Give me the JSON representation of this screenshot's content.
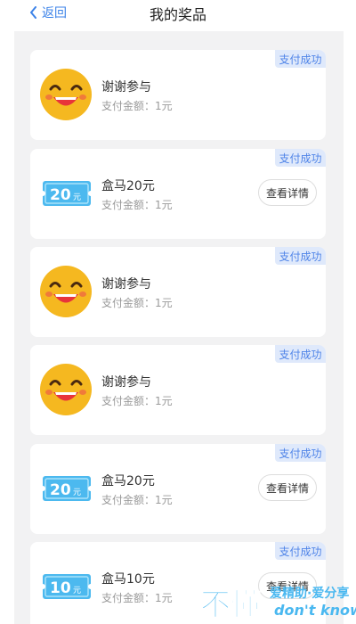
{
  "header": {
    "back_label": "返回",
    "title": "我的奖品"
  },
  "cards": [
    {
      "type": "smiley",
      "name": "谢谢参与",
      "amount": "支付金额：1元",
      "status": "支付成功",
      "has_detail": false
    },
    {
      "type": "coupon",
      "coupon_value": "20",
      "coupon_unit": "元",
      "name": "盒马20元",
      "amount": "支付金额：1元",
      "status": "支付成功",
      "has_detail": true,
      "detail_label": "查看详情"
    },
    {
      "type": "smiley",
      "name": "谢谢参与",
      "amount": "支付金额：1元",
      "status": "支付成功",
      "has_detail": false
    },
    {
      "type": "smiley",
      "name": "谢谢参与",
      "amount": "支付金额：1元",
      "status": "支付成功",
      "has_detail": false
    },
    {
      "type": "coupon",
      "coupon_value": "20",
      "coupon_unit": "元",
      "name": "盒马20元",
      "amount": "支付金额：1元",
      "status": "支付成功",
      "has_detail": true,
      "detail_label": "查看详情"
    },
    {
      "type": "coupon",
      "coupon_value": "10",
      "coupon_unit": "元",
      "name": "盒马10元",
      "amount": "支付金额：1元",
      "status": "支付成功",
      "has_detail": true,
      "detail_label": "查看详情"
    }
  ],
  "watermark": {
    "text_main": "不懂",
    "text_cn": "爱精助·爱分享",
    "text_en": "don't know"
  },
  "colors": {
    "accent": "#3b82e8",
    "badge_bg": "#dfe9fb",
    "badge_text": "#4f84e8",
    "smiley": "#f5b820",
    "coupon": "#4cb9ef"
  }
}
